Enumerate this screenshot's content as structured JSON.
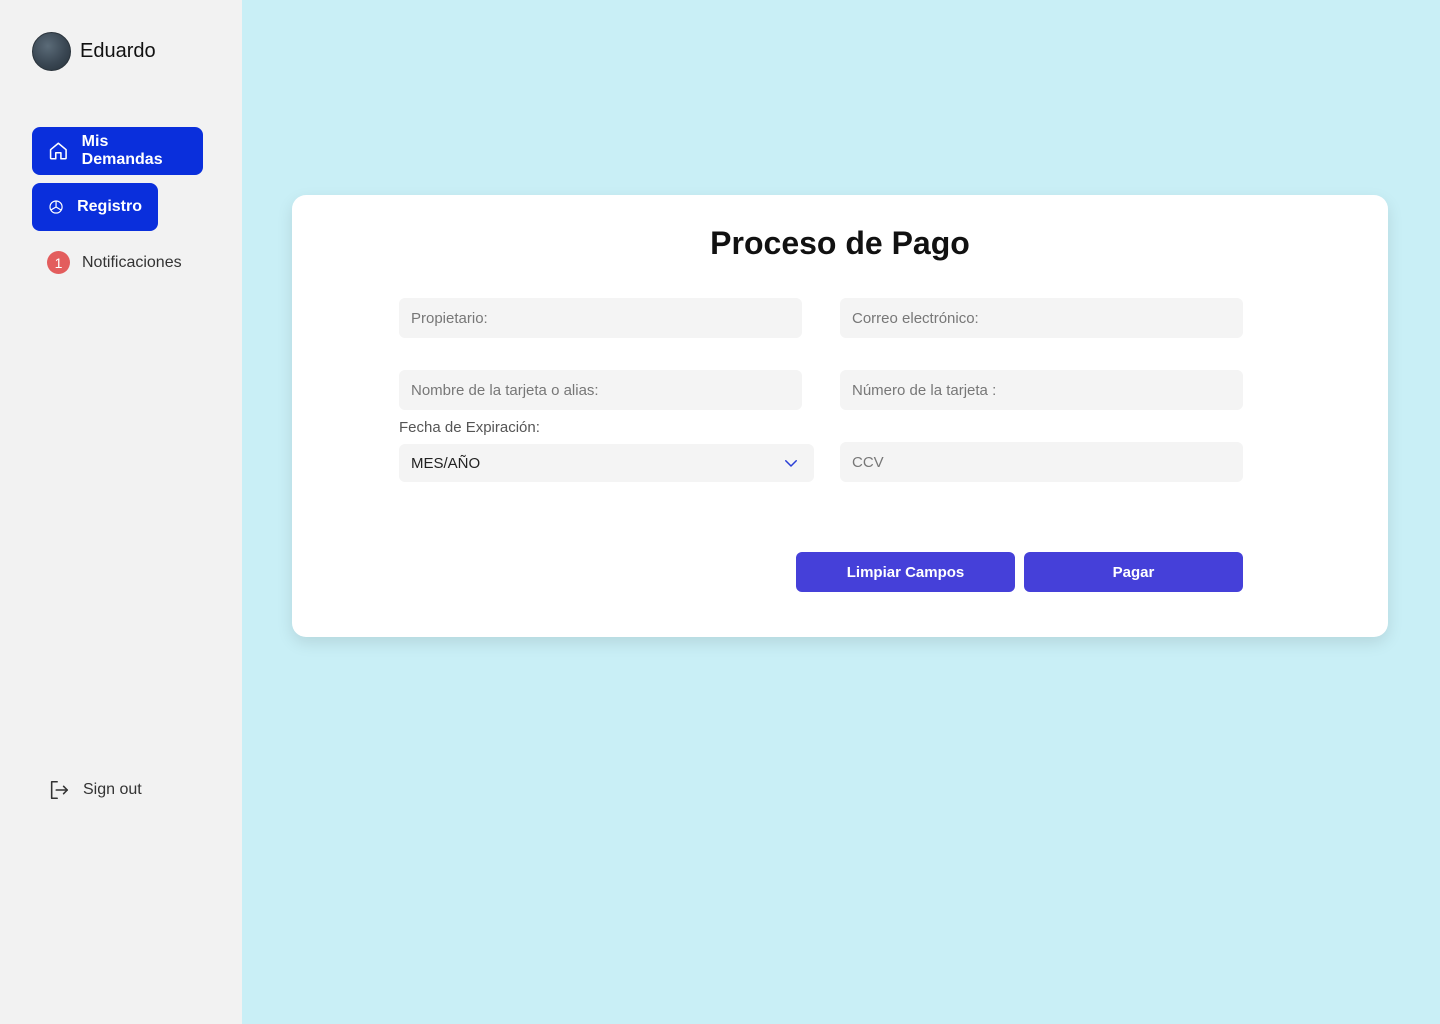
{
  "user": {
    "name": "Eduardo"
  },
  "nav": {
    "mis_demandas": "Mis Demandas",
    "registro": "Registro",
    "notificaciones": "Notificaciones",
    "notif_count": "1"
  },
  "signout": "Sign out",
  "form": {
    "title": "Proceso de Pago",
    "propietario_placeholder": "Propietario:",
    "correo_placeholder": "Correo electrónico:",
    "alias_placeholder": "Nombre de la tarjeta o alias:",
    "numero_placeholder": "Número de la tarjeta :",
    "expiracion_label": "Fecha de Expiración:",
    "expiracion_value": "MES/AÑO",
    "ccv_placeholder": "CCV",
    "clear_button": "Limpiar Campos",
    "pay_button": "Pagar"
  },
  "colors": {
    "sidebar_bg": "#f2f2f2",
    "page_bg": "#c9eff6",
    "nav_active": "#0a2fdc",
    "button": "#4540d9",
    "badge": "#e35d5d"
  },
  "icons": {
    "mis_demandas": "home-icon",
    "registro": "pie-chart-icon",
    "signout": "sign-out-icon",
    "select": "chevron-down-icon"
  }
}
